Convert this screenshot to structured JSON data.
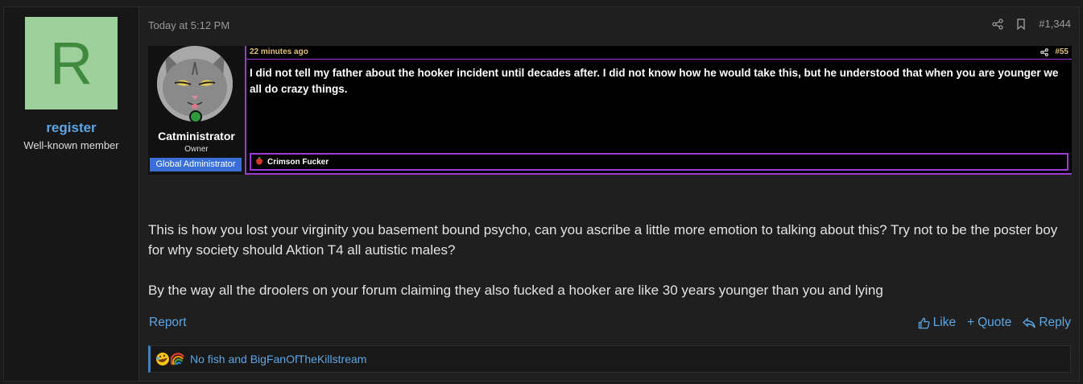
{
  "user": {
    "avatar_letter": "R",
    "name": "register",
    "title": "Well-known member"
  },
  "post": {
    "date": "Today at 5:12 PM",
    "number": "#1,344",
    "embed": {
      "time": "22 minutes ago",
      "number": "#55",
      "author": "Catministrator",
      "role": "Owner",
      "badge": "Global Administrator",
      "text": "I did not tell my father about the hooker incident until decades after. I did not know how he would take this, but he understood that when you are younger we all do crazy things.",
      "signature": "Crimson Fucker"
    },
    "message": [
      "This is how you lost your virginity you basement bound psycho, can you ascribe a little more emotion to talking about this? Try not to be the poster boy for why society should Aktion T4 all autistic males?",
      "By the way all the droolers on your forum claiming they also fucked a hooker are like 30 years younger than you and lying"
    ]
  },
  "footer": {
    "report": "Report",
    "like": "Like",
    "quote": "Quote",
    "reply": "Reply"
  },
  "reactions": {
    "text": "No fish and BigFanOfTheKillstream"
  },
  "colors": {
    "accent": "#5aa6e6",
    "embed_border": "#9b3bd1",
    "avatar_bg": "#9dd09b",
    "admin_badge": "#3a6fd8"
  }
}
